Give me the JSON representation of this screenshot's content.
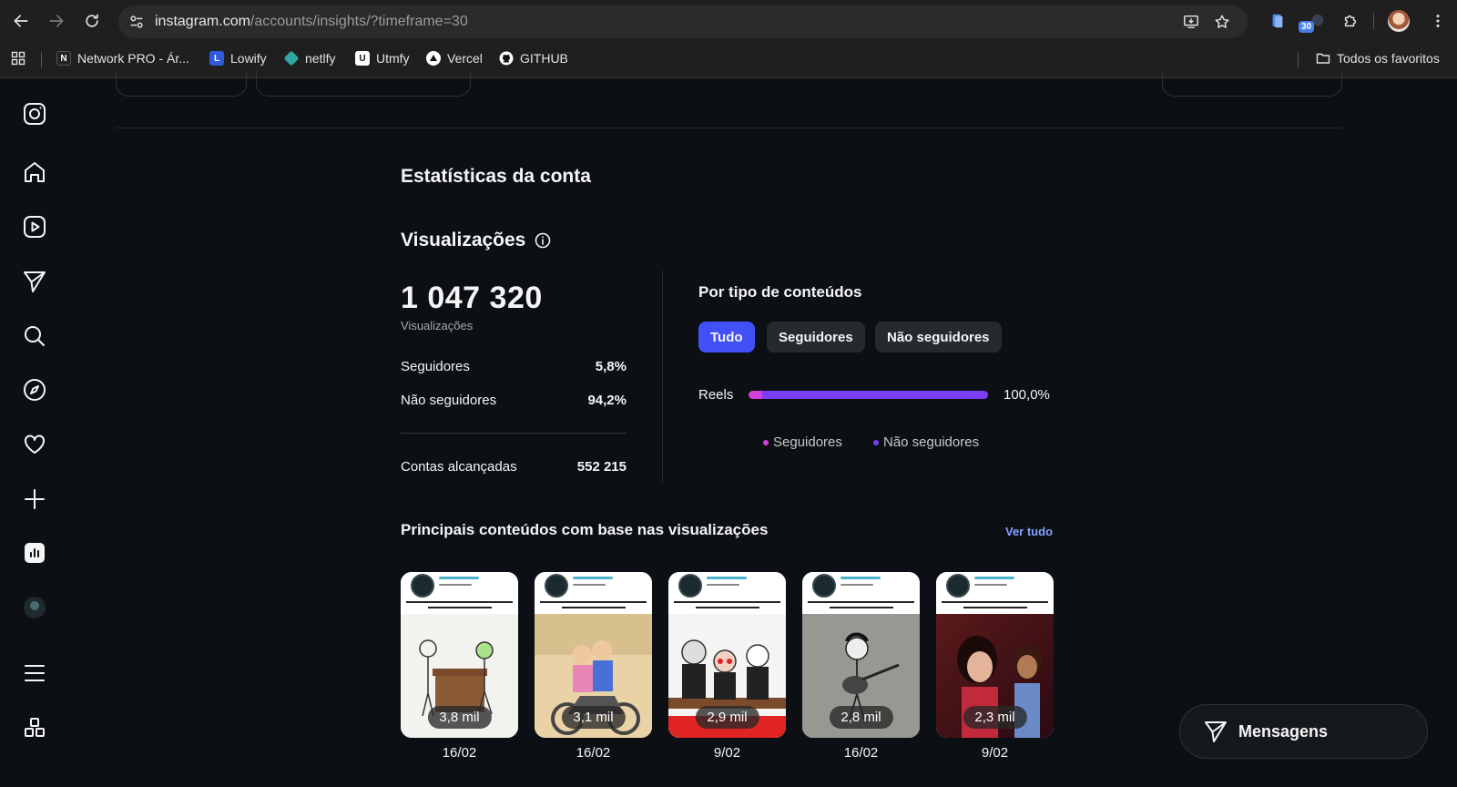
{
  "browser": {
    "url_domain": "instagram.com",
    "url_path": "/accounts/insights/?timeframe=30",
    "extension_badge": "30",
    "bookmarks": [
      {
        "label": "Network PRO - Ár...",
        "icon": "network-pro-icon"
      },
      {
        "label": "Lowify",
        "icon": "lowify-icon"
      },
      {
        "label": "netlfy",
        "icon": "netlify-icon"
      },
      {
        "label": "Utmfy",
        "icon": "utmfy-icon"
      },
      {
        "label": "Vercel",
        "icon": "vercel-icon"
      },
      {
        "label": "GITHUB",
        "icon": "github-icon"
      }
    ],
    "all_bookmarks": "Todos os favoritos"
  },
  "page": {
    "title": "Estatísticas da conta",
    "views_heading": "Visualizações",
    "total_views": "1 047 320",
    "total_views_label": "Visualizações",
    "followers_label": "Seguidores",
    "followers_pct": "5,8%",
    "non_followers_label": "Não seguidores",
    "non_followers_pct": "94,2%",
    "reached_label": "Contas alcançadas",
    "reached_value": "552 215"
  },
  "content_type": {
    "title": "Por tipo de conteúdos",
    "filters": [
      "Tudo",
      "Seguidores",
      "Não seguidores"
    ],
    "active_filter": "Tudo",
    "reels_label": "Reels",
    "reels_pct": "100,0%",
    "reels_followers_share": 0.058,
    "legend_followers": "Seguidores",
    "legend_non_followers": "Não seguidores",
    "colors": {
      "followers": "#d43fd8",
      "non_followers": "#7b3ff2",
      "active_filter": "#4150f7"
    }
  },
  "top_content": {
    "title": "Principais conteúdos com base nas visualizações",
    "see_all": "Ver tudo",
    "items": [
      {
        "views": "3,8 mil",
        "date": "16/02"
      },
      {
        "views": "3,1 mil",
        "date": "16/02"
      },
      {
        "views": "2,9 mil",
        "date": "9/02"
      },
      {
        "views": "2,8 mil",
        "date": "16/02"
      },
      {
        "views": "2,3 mil",
        "date": "9/02"
      }
    ]
  },
  "messages": {
    "label": "Mensagens"
  }
}
